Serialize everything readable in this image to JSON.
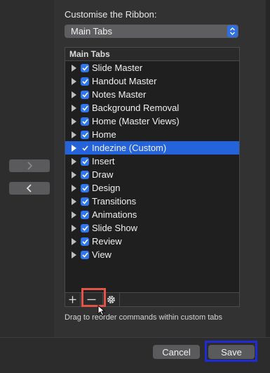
{
  "ribbon": {
    "label": "Customise the Ribbon:",
    "select_value": "Main Tabs"
  },
  "list": {
    "header": "Main Tabs",
    "items": [
      {
        "label": "Slide Master",
        "checked": true
      },
      {
        "label": "Handout Master",
        "checked": true
      },
      {
        "label": "Notes Master",
        "checked": true
      },
      {
        "label": "Background Removal",
        "checked": true
      },
      {
        "label": "Home (Master Views)",
        "checked": true
      },
      {
        "label": "Home",
        "checked": true
      },
      {
        "label": "Indezine (Custom)",
        "checked": true,
        "selected": true
      },
      {
        "label": "Insert",
        "checked": true
      },
      {
        "label": "Draw",
        "checked": true
      },
      {
        "label": "Design",
        "checked": true
      },
      {
        "label": "Transitions",
        "checked": true
      },
      {
        "label": "Animations",
        "checked": true
      },
      {
        "label": "Slide Show",
        "checked": true
      },
      {
        "label": "Review",
        "checked": true
      },
      {
        "label": "View",
        "checked": true
      }
    ]
  },
  "hint": "Drag to reorder commands within custom tabs",
  "footer": {
    "cancel_label": "Cancel",
    "save_label": "Save"
  },
  "colors": {
    "accent": "#2f77f0",
    "selected_row": "#2463d9",
    "highlight_red": "#e25446",
    "highlight_blue": "#1f2bd6"
  }
}
